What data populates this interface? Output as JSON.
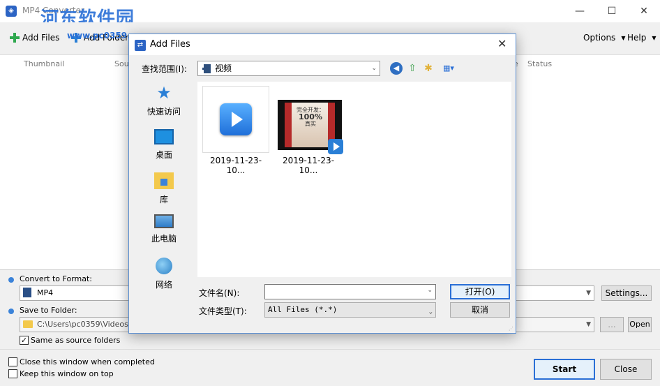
{
  "main": {
    "title": "MP4 Converter",
    "watermark": "河东软件园",
    "watermark_url": "www.pc0359.cn",
    "toolbar": {
      "add_files": "Add Files",
      "add_folder": "Add Folder",
      "options": "Options",
      "help": "Help"
    },
    "columns": {
      "thumbnail": "Thumbnail",
      "source": "Sou",
      "e": "e",
      "status": "Status"
    },
    "convert_label": "Convert to Format:",
    "format_value": "MP4",
    "settings_button": "Settings...",
    "save_label": "Save to Folder:",
    "folder_value": "C:\\Users\\pc0359\\Videos",
    "browse_button": "...",
    "open_button": "Open",
    "same_as_source": "Same as source folders",
    "close_when_done": "Close this window when completed",
    "keep_on_top": "Keep this window on top",
    "start_button": "Start",
    "close_button": "Close"
  },
  "dialog": {
    "title": "Add Files",
    "look_in_label": "查找范围(I):",
    "look_in_value": "视频",
    "places": [
      {
        "label": "快速访问"
      },
      {
        "label": "桌面"
      },
      {
        "label": "库"
      },
      {
        "label": "此电脑"
      },
      {
        "label": "网络"
      }
    ],
    "files": [
      {
        "name": "2019-11-23-10..."
      },
      {
        "name": "2019-11-23-10..."
      }
    ],
    "thumb_text": {
      "line1": "完全开发：",
      "line2": "100%",
      "line3": "真实"
    },
    "filename_label": "文件名(N):",
    "filename_value": "",
    "filetype_label": "文件类型(T):",
    "filetype_value": "All Files (*.*)",
    "open_button": "打开(O)",
    "cancel_button": "取消"
  }
}
